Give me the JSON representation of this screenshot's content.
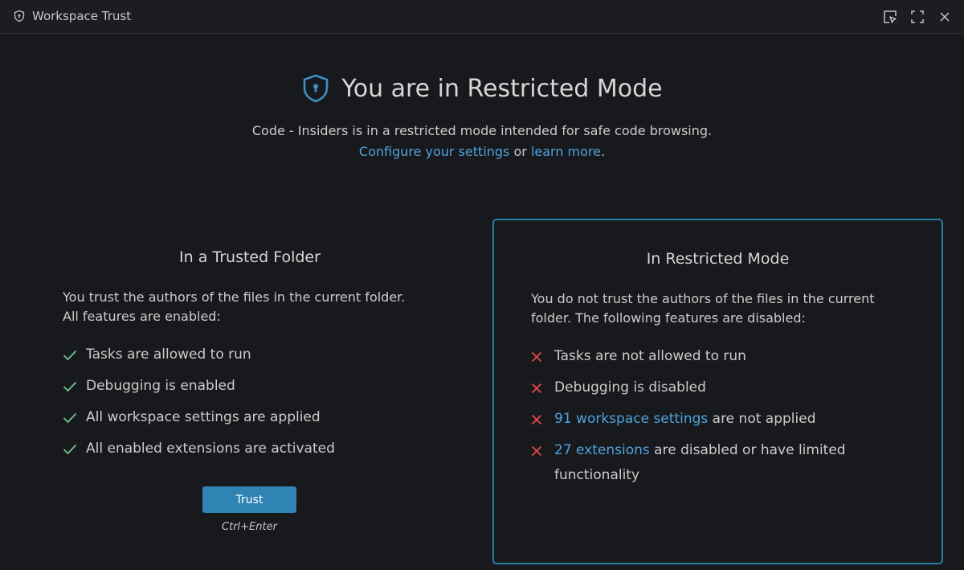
{
  "titlebar": {
    "title": "Workspace Trust",
    "icons": [
      "shield-icon",
      "pick-element-icon",
      "maximize-icon",
      "close-icon"
    ]
  },
  "header": {
    "title": "You are in Restricted Mode",
    "description": "Code - Insiders is in a restricted mode intended for safe code browsing.",
    "configure_link": "Configure your settings",
    "or_text": " or ",
    "learn_link": "learn more",
    "period": "."
  },
  "trusted": {
    "title": "In a Trusted Folder",
    "description": "You trust the authors of the files in the current folder. All features are enabled:",
    "items": [
      "Tasks are allowed to run",
      "Debugging is enabled",
      "All workspace settings are applied",
      "All enabled extensions are activated"
    ],
    "button_label": "Trust",
    "shortcut": "Ctrl+Enter"
  },
  "restricted": {
    "title": "In Restricted Mode",
    "description": "You do not trust the authors of the files in the current folder. The following features are disabled:",
    "items": [
      {
        "text": "Tasks are not allowed to run"
      },
      {
        "text": "Debugging is disabled"
      },
      {
        "link": "91 workspace settings",
        "text": " are not applied"
      },
      {
        "link": "27 extensions",
        "text": " are disabled or have limited functionality"
      }
    ]
  },
  "colors": {
    "accent": "#2f84b3",
    "link": "#4ea3e0",
    "check": "#73c991",
    "cross": "#f14c4c"
  }
}
